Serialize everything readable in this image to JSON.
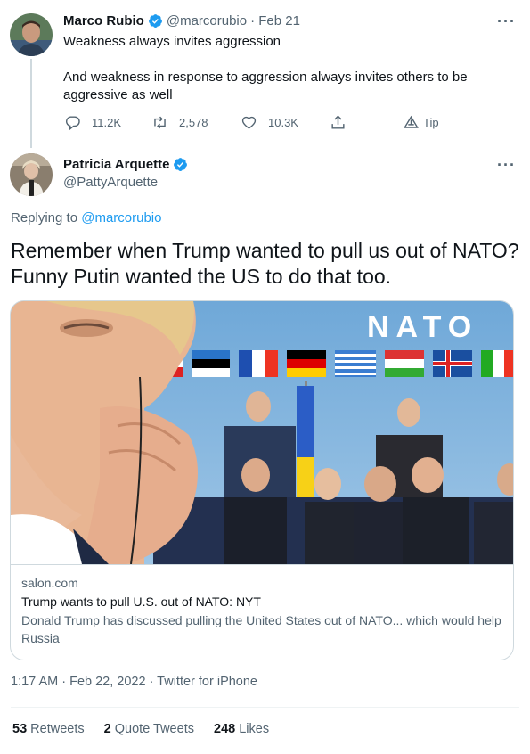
{
  "parent_tweet": {
    "name": "Marco Rubio",
    "handle": "@marcorubio",
    "date": "· Feb 21",
    "text": "Weakness always invites aggression\n\nAnd weakness in response to aggression always invites others to be\naggressive as well",
    "actions": {
      "replies": "11.2K",
      "retweets": "2,578",
      "likes": "10.3K",
      "tip": "Tip"
    }
  },
  "main_tweet": {
    "name": "Patricia Arquette",
    "handle": "@PattyArquette",
    "replying_prefix": "Replying to",
    "replying_to": "@marcorubio",
    "text": "Remember when Trump wanted to pull us out of NATO? Funny Putin wanted the US to do that too.",
    "card": {
      "image_banner": "NATO",
      "domain": "salon.com",
      "title": "Trump wants to pull U.S. out of NATO: NYT",
      "description": "Donald Trump has discussed pulling the United States out of NATO... which would help Russia"
    },
    "timestamp": "1:17 AM · Feb 22, 2022 · Twitter for iPhone",
    "stats": {
      "retweets_count": "53",
      "retweets_label": "Retweets",
      "quotes_count": "2",
      "quotes_label": "Quote Tweets",
      "likes_count": "248",
      "likes_label": "Likes"
    }
  },
  "colors": {
    "accent": "#1d9bf0",
    "text": "#0f1419",
    "secondary": "#536471",
    "border": "#cfd9de"
  },
  "icons": [
    "verified-badge-icon",
    "more-icon",
    "reply-icon",
    "retweet-icon",
    "like-icon",
    "share-icon",
    "tip-icon"
  ]
}
